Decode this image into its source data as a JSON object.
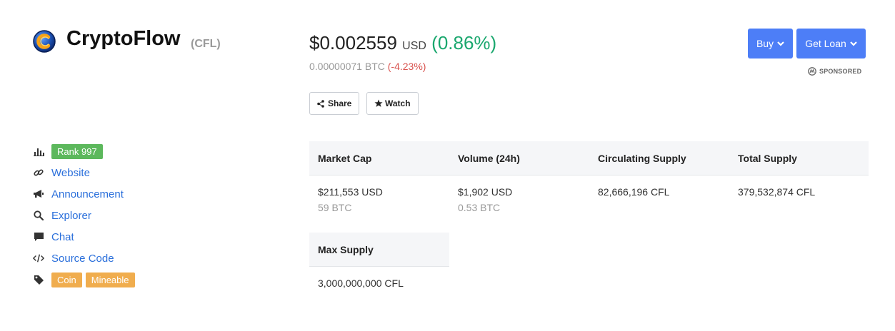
{
  "coin": {
    "name": "CryptoFlow",
    "symbol": "(CFL)",
    "logo_icon": "cryptoflow-logo-icon"
  },
  "price": {
    "usd_value": "$0.002559",
    "usd_currency": "USD",
    "usd_change": "(0.86%)",
    "btc_value": "0.00000071 BTC",
    "btc_change": "(-4.23%)"
  },
  "actions": {
    "share_label": "Share",
    "watch_label": "Watch",
    "buy_label": "Buy",
    "loan_label": "Get Loan",
    "sponsored_label": "SPONSORED"
  },
  "sidebar": {
    "rank_label": "Rank 997",
    "links": [
      {
        "label": "Website",
        "icon": "link-icon"
      },
      {
        "label": "Announcement",
        "icon": "megaphone-icon"
      },
      {
        "label": "Explorer",
        "icon": "search-icon"
      },
      {
        "label": "Chat",
        "icon": "chat-icon"
      },
      {
        "label": "Source Code",
        "icon": "code-icon"
      }
    ],
    "tags": [
      "Coin",
      "Mineable"
    ]
  },
  "stats": {
    "market_cap": {
      "label": "Market Cap",
      "value": "$211,553 USD",
      "sub": "59 BTC"
    },
    "volume": {
      "label": "Volume (24h)",
      "value": "$1,902 USD",
      "sub": "0.53 BTC"
    },
    "circulating": {
      "label": "Circulating Supply",
      "value": "82,666,196 CFL"
    },
    "total": {
      "label": "Total Supply",
      "value": "379,532,874 CFL"
    },
    "max": {
      "label": "Max Supply",
      "value": "3,000,000,000 CFL"
    }
  },
  "colors": {
    "accent_blue": "#4d7ef7",
    "link_blue": "#2a6fdb",
    "positive": "#1aa76e",
    "negative": "#d9534f",
    "rank_badge": "#5cb85c",
    "tag_badge": "#f0ad4e"
  }
}
